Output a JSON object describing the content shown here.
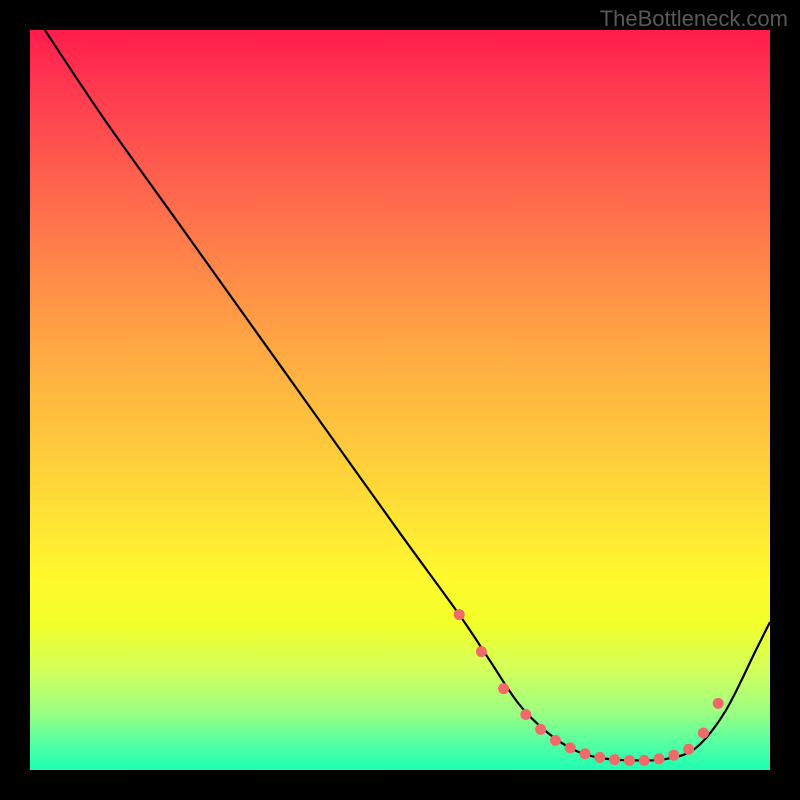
{
  "watermark": "TheBottleneck.com",
  "chart_data": {
    "type": "line",
    "title": "",
    "xlabel": "",
    "ylabel": "",
    "xlim": [
      0,
      100
    ],
    "ylim": [
      0,
      100
    ],
    "series": [
      {
        "name": "curve",
        "x": [
          2,
          10,
          20,
          30,
          40,
          50,
          58,
          62,
          66,
          70,
          74,
          78,
          82,
          86,
          90,
          94,
          98,
          100
        ],
        "y": [
          100,
          88,
          74,
          60,
          46,
          32,
          21,
          15,
          9,
          5,
          2.5,
          1.5,
          1.3,
          1.5,
          3,
          8,
          16,
          20
        ]
      }
    ],
    "markers": {
      "name": "dots",
      "x": [
        58,
        61,
        64,
        67,
        69,
        71,
        73,
        75,
        77,
        79,
        81,
        83,
        85,
        87,
        89,
        91,
        93
      ],
      "y": [
        21,
        16,
        11,
        7.5,
        5.5,
        4,
        3,
        2.2,
        1.7,
        1.4,
        1.3,
        1.3,
        1.5,
        2,
        2.8,
        5,
        9
      ]
    }
  },
  "colors": {
    "dot": "#f06a6a",
    "curve": "#000000",
    "bg_top": "#ff1c4c",
    "bg_bottom": "#1cffb4"
  }
}
